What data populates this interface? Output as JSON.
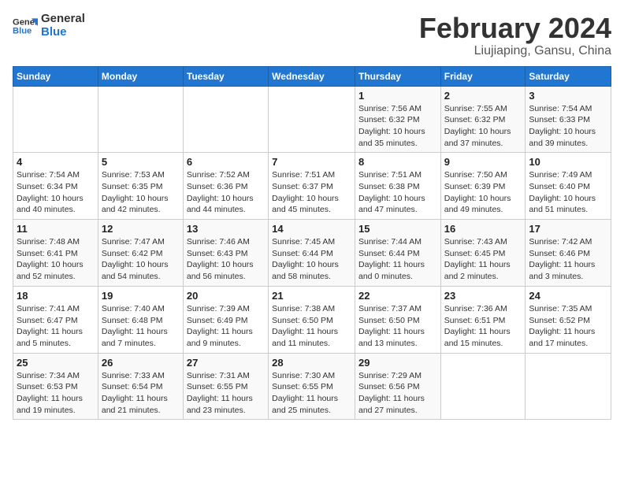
{
  "logo": {
    "line1": "General",
    "line2": "Blue"
  },
  "title": "February 2024",
  "subtitle": "Liujiaping, Gansu, China",
  "days_of_week": [
    "Sunday",
    "Monday",
    "Tuesday",
    "Wednesday",
    "Thursday",
    "Friday",
    "Saturday"
  ],
  "weeks": [
    [
      {
        "day": "",
        "info": ""
      },
      {
        "day": "",
        "info": ""
      },
      {
        "day": "",
        "info": ""
      },
      {
        "day": "",
        "info": ""
      },
      {
        "day": "1",
        "info": "Sunrise: 7:56 AM\nSunset: 6:32 PM\nDaylight: 10 hours and 35 minutes."
      },
      {
        "day": "2",
        "info": "Sunrise: 7:55 AM\nSunset: 6:32 PM\nDaylight: 10 hours and 37 minutes."
      },
      {
        "day": "3",
        "info": "Sunrise: 7:54 AM\nSunset: 6:33 PM\nDaylight: 10 hours and 39 minutes."
      }
    ],
    [
      {
        "day": "4",
        "info": "Sunrise: 7:54 AM\nSunset: 6:34 PM\nDaylight: 10 hours and 40 minutes."
      },
      {
        "day": "5",
        "info": "Sunrise: 7:53 AM\nSunset: 6:35 PM\nDaylight: 10 hours and 42 minutes."
      },
      {
        "day": "6",
        "info": "Sunrise: 7:52 AM\nSunset: 6:36 PM\nDaylight: 10 hours and 44 minutes."
      },
      {
        "day": "7",
        "info": "Sunrise: 7:51 AM\nSunset: 6:37 PM\nDaylight: 10 hours and 45 minutes."
      },
      {
        "day": "8",
        "info": "Sunrise: 7:51 AM\nSunset: 6:38 PM\nDaylight: 10 hours and 47 minutes."
      },
      {
        "day": "9",
        "info": "Sunrise: 7:50 AM\nSunset: 6:39 PM\nDaylight: 10 hours and 49 minutes."
      },
      {
        "day": "10",
        "info": "Sunrise: 7:49 AM\nSunset: 6:40 PM\nDaylight: 10 hours and 51 minutes."
      }
    ],
    [
      {
        "day": "11",
        "info": "Sunrise: 7:48 AM\nSunset: 6:41 PM\nDaylight: 10 hours and 52 minutes."
      },
      {
        "day": "12",
        "info": "Sunrise: 7:47 AM\nSunset: 6:42 PM\nDaylight: 10 hours and 54 minutes."
      },
      {
        "day": "13",
        "info": "Sunrise: 7:46 AM\nSunset: 6:43 PM\nDaylight: 10 hours and 56 minutes."
      },
      {
        "day": "14",
        "info": "Sunrise: 7:45 AM\nSunset: 6:44 PM\nDaylight: 10 hours and 58 minutes."
      },
      {
        "day": "15",
        "info": "Sunrise: 7:44 AM\nSunset: 6:44 PM\nDaylight: 11 hours and 0 minutes."
      },
      {
        "day": "16",
        "info": "Sunrise: 7:43 AM\nSunset: 6:45 PM\nDaylight: 11 hours and 2 minutes."
      },
      {
        "day": "17",
        "info": "Sunrise: 7:42 AM\nSunset: 6:46 PM\nDaylight: 11 hours and 3 minutes."
      }
    ],
    [
      {
        "day": "18",
        "info": "Sunrise: 7:41 AM\nSunset: 6:47 PM\nDaylight: 11 hours and 5 minutes."
      },
      {
        "day": "19",
        "info": "Sunrise: 7:40 AM\nSunset: 6:48 PM\nDaylight: 11 hours and 7 minutes."
      },
      {
        "day": "20",
        "info": "Sunrise: 7:39 AM\nSunset: 6:49 PM\nDaylight: 11 hours and 9 minutes."
      },
      {
        "day": "21",
        "info": "Sunrise: 7:38 AM\nSunset: 6:50 PM\nDaylight: 11 hours and 11 minutes."
      },
      {
        "day": "22",
        "info": "Sunrise: 7:37 AM\nSunset: 6:50 PM\nDaylight: 11 hours and 13 minutes."
      },
      {
        "day": "23",
        "info": "Sunrise: 7:36 AM\nSunset: 6:51 PM\nDaylight: 11 hours and 15 minutes."
      },
      {
        "day": "24",
        "info": "Sunrise: 7:35 AM\nSunset: 6:52 PM\nDaylight: 11 hours and 17 minutes."
      }
    ],
    [
      {
        "day": "25",
        "info": "Sunrise: 7:34 AM\nSunset: 6:53 PM\nDaylight: 11 hours and 19 minutes."
      },
      {
        "day": "26",
        "info": "Sunrise: 7:33 AM\nSunset: 6:54 PM\nDaylight: 11 hours and 21 minutes."
      },
      {
        "day": "27",
        "info": "Sunrise: 7:31 AM\nSunset: 6:55 PM\nDaylight: 11 hours and 23 minutes."
      },
      {
        "day": "28",
        "info": "Sunrise: 7:30 AM\nSunset: 6:55 PM\nDaylight: 11 hours and 25 minutes."
      },
      {
        "day": "29",
        "info": "Sunrise: 7:29 AM\nSunset: 6:56 PM\nDaylight: 11 hours and 27 minutes."
      },
      {
        "day": "",
        "info": ""
      },
      {
        "day": "",
        "info": ""
      }
    ]
  ]
}
